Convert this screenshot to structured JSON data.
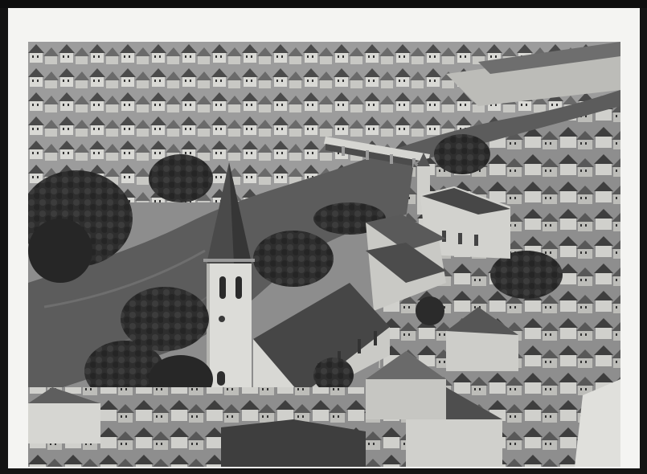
{
  "photo": {
    "subject": "aerial-town-church-river",
    "tone": "black-and-white",
    "colors": {
      "river": "#5c5c5c",
      "roofs_dark": "#3a3a3a",
      "roofs_light": "#a9a9a9",
      "walls": "#d4d4d0",
      "trees": "#2b2b2b",
      "mount": "#f4f4f2",
      "background": "#141414"
    }
  }
}
